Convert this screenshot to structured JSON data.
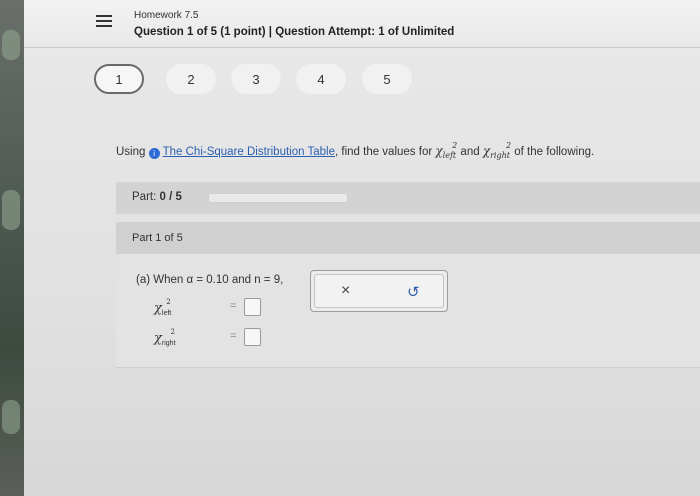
{
  "header": {
    "homework_title": "Homework 7.5",
    "question_info": "Question 1 of 5 (1 point)  |  Question Attempt: 1 of Unlimited"
  },
  "question_nav": [
    "1",
    "2",
    "3",
    "4",
    "5"
  ],
  "question": {
    "prefix": "Using",
    "link_text": "The Chi-Square Distribution Table",
    "middle": ", find the values for",
    "and": "and",
    "suffix": "of the following.",
    "chi_symbol": "χ",
    "sup": "2",
    "left_sub": "left",
    "right_sub": "right"
  },
  "part_progress": {
    "label": "Part:",
    "value": "0 / 5",
    "progress_fraction": 0
  },
  "part_header": "Part 1 of 5",
  "prompt": {
    "text": "(a) When α = 0.10 and n = 9,"
  },
  "answers": [
    {
      "symbol": "χ",
      "sup": "2",
      "sub": "left",
      "eq": "=",
      "value": ""
    },
    {
      "symbol": "χ",
      "sup": "2",
      "sub": "right",
      "eq": "=",
      "value": ""
    }
  ],
  "tools": {
    "clear_icon": "×",
    "undo_icon": "↺"
  },
  "colors": {
    "link": "#2b5fb0",
    "info": "#2f6bd6",
    "undo": "#2f5fae"
  }
}
